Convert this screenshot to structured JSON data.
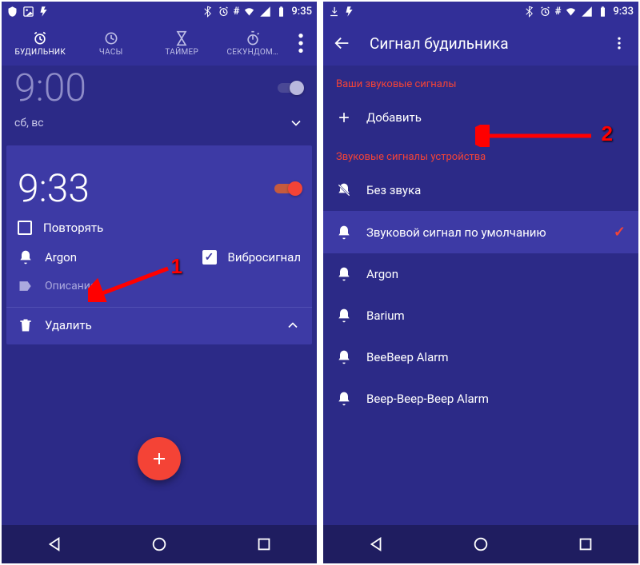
{
  "left": {
    "status_time": "9:35",
    "tabs": {
      "alarm": "БУДИЛЬНИК",
      "clock": "ЧАСЫ",
      "timer": "ТАЙМЕР",
      "stopwatch": "СЕКУНДОМ…"
    },
    "collapsed": {
      "time": "9:00",
      "days": "сб, вс"
    },
    "expanded": {
      "time": "9:33",
      "repeat_label": "Повторять",
      "sound_label": "Argon",
      "vibrate_label": "Вибросигнал",
      "desc_placeholder": "Описание",
      "delete_label": "Удалить"
    },
    "annotation1": "1"
  },
  "right": {
    "status_time": "9:33",
    "title": "Сигнал будильника",
    "section_user": "Ваши звуковые сигналы",
    "add_label": "Добавить",
    "section_device": "Звуковые сигналы устройства",
    "items": [
      "Без звука",
      "Звуковой сигнал по умолчанию",
      "Argon",
      "Barium",
      "BeeBeep Alarm",
      "Beep-Beep-Beep Alarm"
    ],
    "annotation2": "2"
  }
}
